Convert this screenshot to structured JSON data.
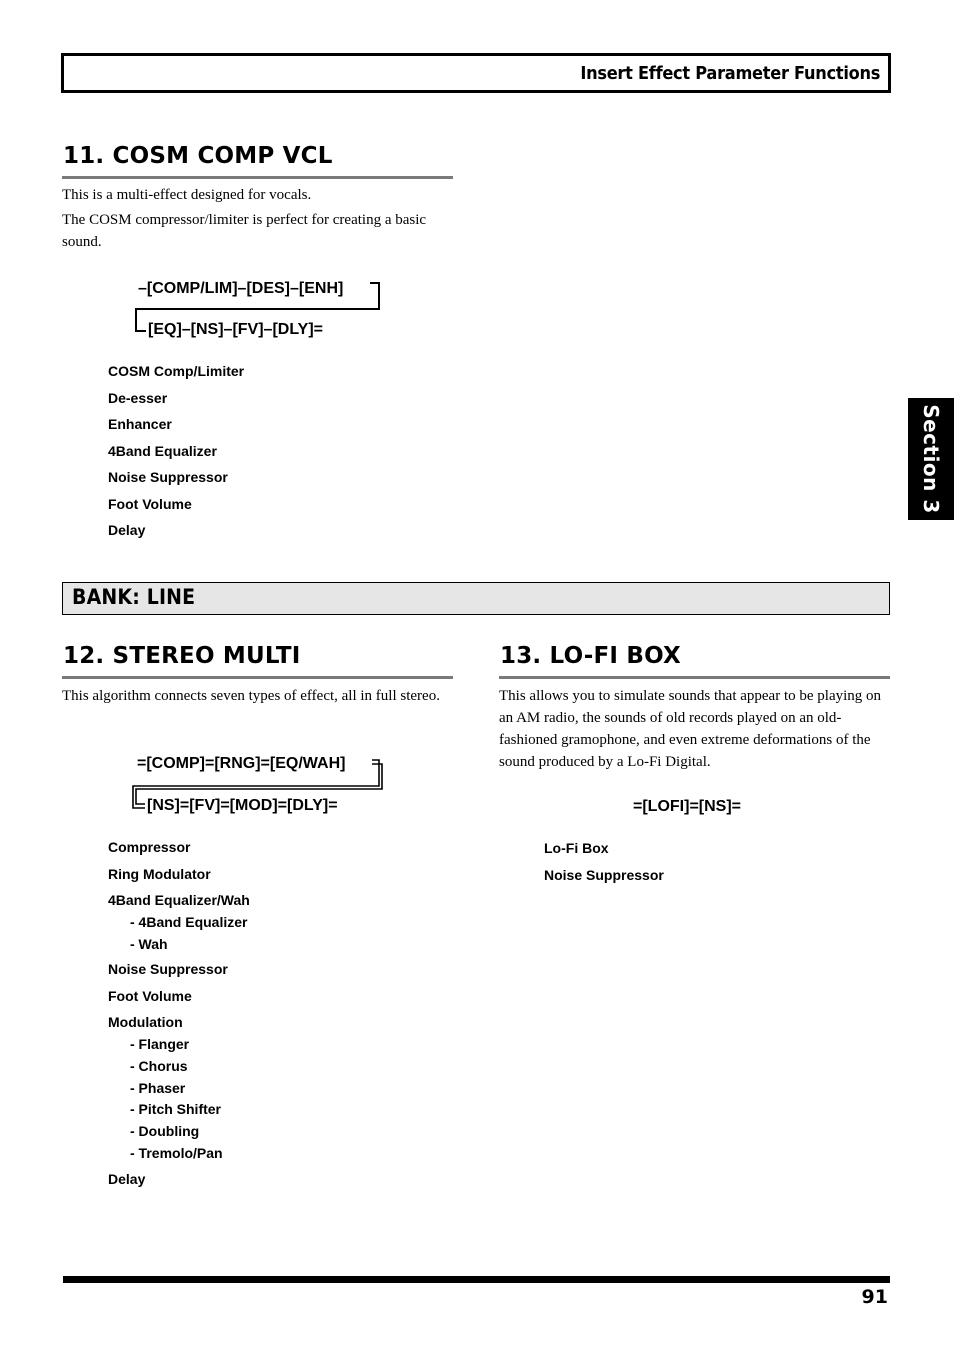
{
  "header": {
    "title": "Insert Effect Parameter Functions"
  },
  "section_tab": {
    "label": "Section 3"
  },
  "cosm_comp_vcl": {
    "heading": "11. COSM COMP VCL",
    "paragraphs": [
      "This is a multi-effect designed for vocals.",
      "The COSM compressor/limiter is perfect for creating a basic sound."
    ],
    "flow_line1": "–[COMP/LIM]–[DES]–[ENH]",
    "flow_line2": "[EQ]–[NS]–[FV]–[DLY]=",
    "effects": [
      "COSM Comp/Limiter",
      "De-esser",
      "Enhancer",
      "4Band Equalizer",
      "Noise Suppressor",
      "Foot Volume",
      "Delay"
    ]
  },
  "bank": {
    "label": "BANK: LINE"
  },
  "stereo_multi": {
    "heading": "12. STEREO MULTI",
    "paragraph": "This algorithm connects seven types of effect, all in full stereo.",
    "flow_line1": "=[COMP]=[RNG]=[EQ/WAH]",
    "flow_line2": "[NS]=[FV]=[MOD]=[DLY]=",
    "effects": {
      "compressor": "Compressor",
      "ring_modulator": "Ring Modulator",
      "eq_wah": "4Band Equalizer/Wah",
      "eq_wah_subs": [
        "- 4Band Equalizer",
        "- Wah"
      ],
      "noise_suppressor": "Noise Suppressor",
      "foot_volume": "Foot Volume",
      "modulation": "Modulation",
      "modulation_subs": [
        "- Flanger",
        "- Chorus",
        "- Phaser",
        "- Pitch Shifter",
        "- Doubling",
        "- Tremolo/Pan"
      ],
      "delay": "Delay"
    }
  },
  "lofi_box": {
    "heading": "13. LO-FI BOX",
    "paragraph": "This allows you to simulate sounds that appear to be playing on an AM radio, the sounds of old records played on an old-fashioned gramophone, and even extreme deformations of the sound produced by a Lo-Fi Digital.",
    "flow": "=[LOFI]=[NS]=",
    "effects": [
      "Lo-Fi Box",
      "Noise Suppressor"
    ]
  },
  "footer": {
    "page_number": "91"
  }
}
